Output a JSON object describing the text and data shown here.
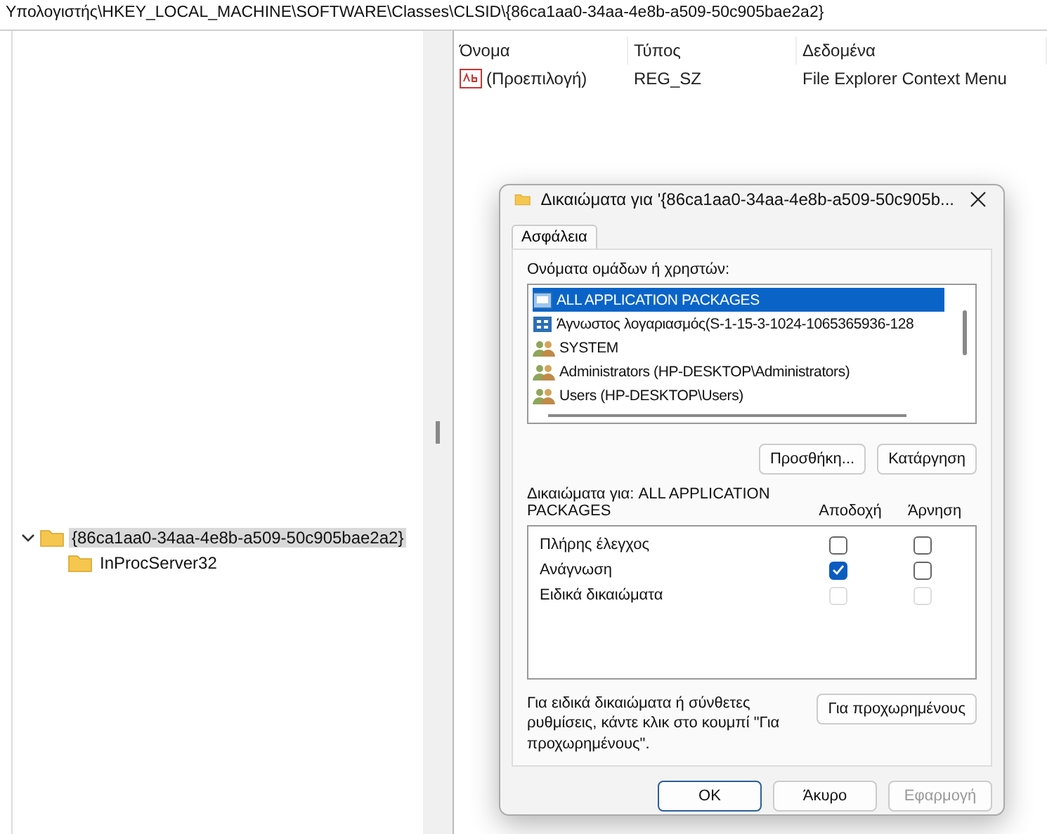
{
  "address_bar": "Υπολογιστής\\HKEY_LOCAL_MACHINE\\SOFTWARE\\Classes\\CLSID\\{86ca1aa0-34aa-4e8b-a509-50c905bae2a2}",
  "tree": {
    "items": [
      {
        "label": "{86ca1aa0-34aa-4e8b-a509-50c905bae2a2}",
        "selected": true,
        "expanded": true,
        "children": [
          {
            "label": "InProcServer32",
            "selected": false
          }
        ]
      }
    ]
  },
  "values": {
    "columns": [
      "Όνομα",
      "Τύπος",
      "Δεδομένα"
    ],
    "rows": [
      {
        "name": "(Προεπιλογή)",
        "type": "REG_SZ",
        "data": "File Explorer Context Menu"
      }
    ]
  },
  "dialog": {
    "title": "Δικαιώματα για '{86ca1aa0-34aa-4e8b-a509-50c905b...",
    "tabs": [
      {
        "label": "Ασφάλεια",
        "selected": true
      }
    ],
    "users_label": "Ονόματα ομάδων ή χρηστών:",
    "users": [
      {
        "kind": "package",
        "label": "ALL APPLICATION PACKAGES",
        "selected": true
      },
      {
        "kind": "account",
        "label": "Άγνωστος λογαριασμός(S-1-15-3-1024-1065365936-128",
        "selected": false
      },
      {
        "kind": "group",
        "label": "SYSTEM",
        "selected": false
      },
      {
        "kind": "group",
        "label": "Administrators (HP-DESKTOP\\Administrators)",
        "selected": false
      },
      {
        "kind": "group",
        "label": "Users (HP-DESKTOP\\Users)",
        "selected": false
      }
    ],
    "user_buttons": [
      "Προσθήκη...",
      "Κατάργηση"
    ],
    "permissions_label": "Δικαιώματα για: ALL APPLICATION PACKAGES",
    "permission_columns": [
      "Αποδοχή",
      "Άρνηση"
    ],
    "permissions": [
      {
        "name": "Πλήρης έλεγχος",
        "allow": {
          "checked": false,
          "disabled": false
        },
        "deny": {
          "checked": false,
          "disabled": false
        }
      },
      {
        "name": "Ανάγνωση",
        "allow": {
          "checked": true,
          "disabled": false
        },
        "deny": {
          "checked": false,
          "disabled": false
        }
      },
      {
        "name": "Ειδικά δικαιώματα",
        "allow": {
          "checked": false,
          "disabled": true
        },
        "deny": {
          "checked": false,
          "disabled": true
        }
      }
    ],
    "advanced_text": "Για ειδικά δικαιώματα ή σύνθετες ρυθμίσεις, κάντε κλικ στο κουμπί \"Για προχωρημένους\".",
    "advanced_button": "Για προχωρημένους",
    "buttons": [
      {
        "label": "OK",
        "kind": "default",
        "disabled": false
      },
      {
        "label": "Άκυρο",
        "kind": "normal",
        "disabled": false
      },
      {
        "label": "Εφαρμογή",
        "kind": "normal",
        "disabled": true
      }
    ]
  }
}
